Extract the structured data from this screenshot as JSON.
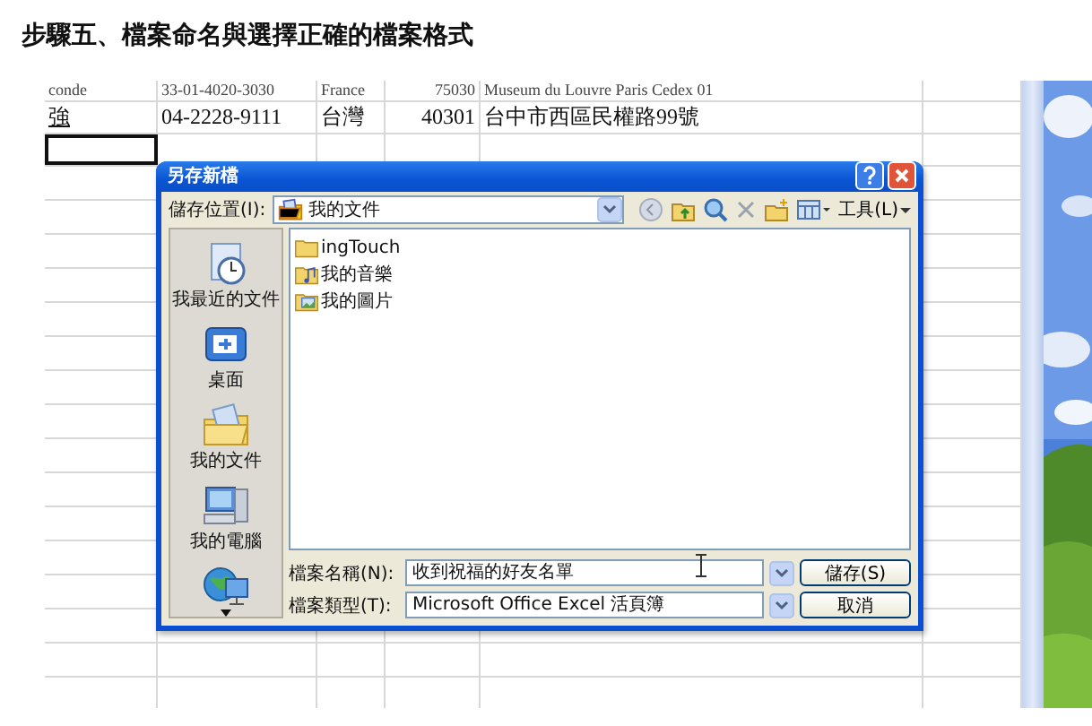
{
  "heading": "步驟五、檔案命名與選擇正確的檔案格式",
  "sheet": {
    "rows": [
      {
        "cells": [
          "conde",
          "33-01-4020-3030",
          "France",
          "75030",
          "Museum du Louvre Paris Cedex 01"
        ],
        "selected": false
      },
      {
        "cells": [
          "強",
          "04-2228-9111",
          "台灣",
          "40301",
          "台中市西區民權路99號"
        ],
        "selected": false
      },
      {
        "selected": true
      }
    ]
  },
  "dialog": {
    "title": "另存新檔",
    "location_label": "儲存位置(I):",
    "location": "我的文件",
    "tools_menu": "工具(L)",
    "places": [
      {
        "label": "我最近的文件",
        "kind": "recent"
      },
      {
        "label": "桌面",
        "kind": "desktop"
      },
      {
        "label": "我的文件",
        "kind": "documents"
      },
      {
        "label": "我的電腦",
        "kind": "computer"
      },
      {
        "kind": "network"
      }
    ],
    "files": [
      {
        "name": "ingTouch",
        "kind": "folder"
      },
      {
        "name": "我的音樂",
        "kind": "music"
      },
      {
        "name": "我的圖片",
        "kind": "pictures"
      }
    ],
    "filename_label": "檔案名稱(N):",
    "filename": "收到祝福的好友名單",
    "filetype_label": "檔案類型(T):",
    "filetype": "Microsoft Office Excel 活頁簿",
    "buttons": [
      "儲存(S)",
      "取消"
    ]
  }
}
